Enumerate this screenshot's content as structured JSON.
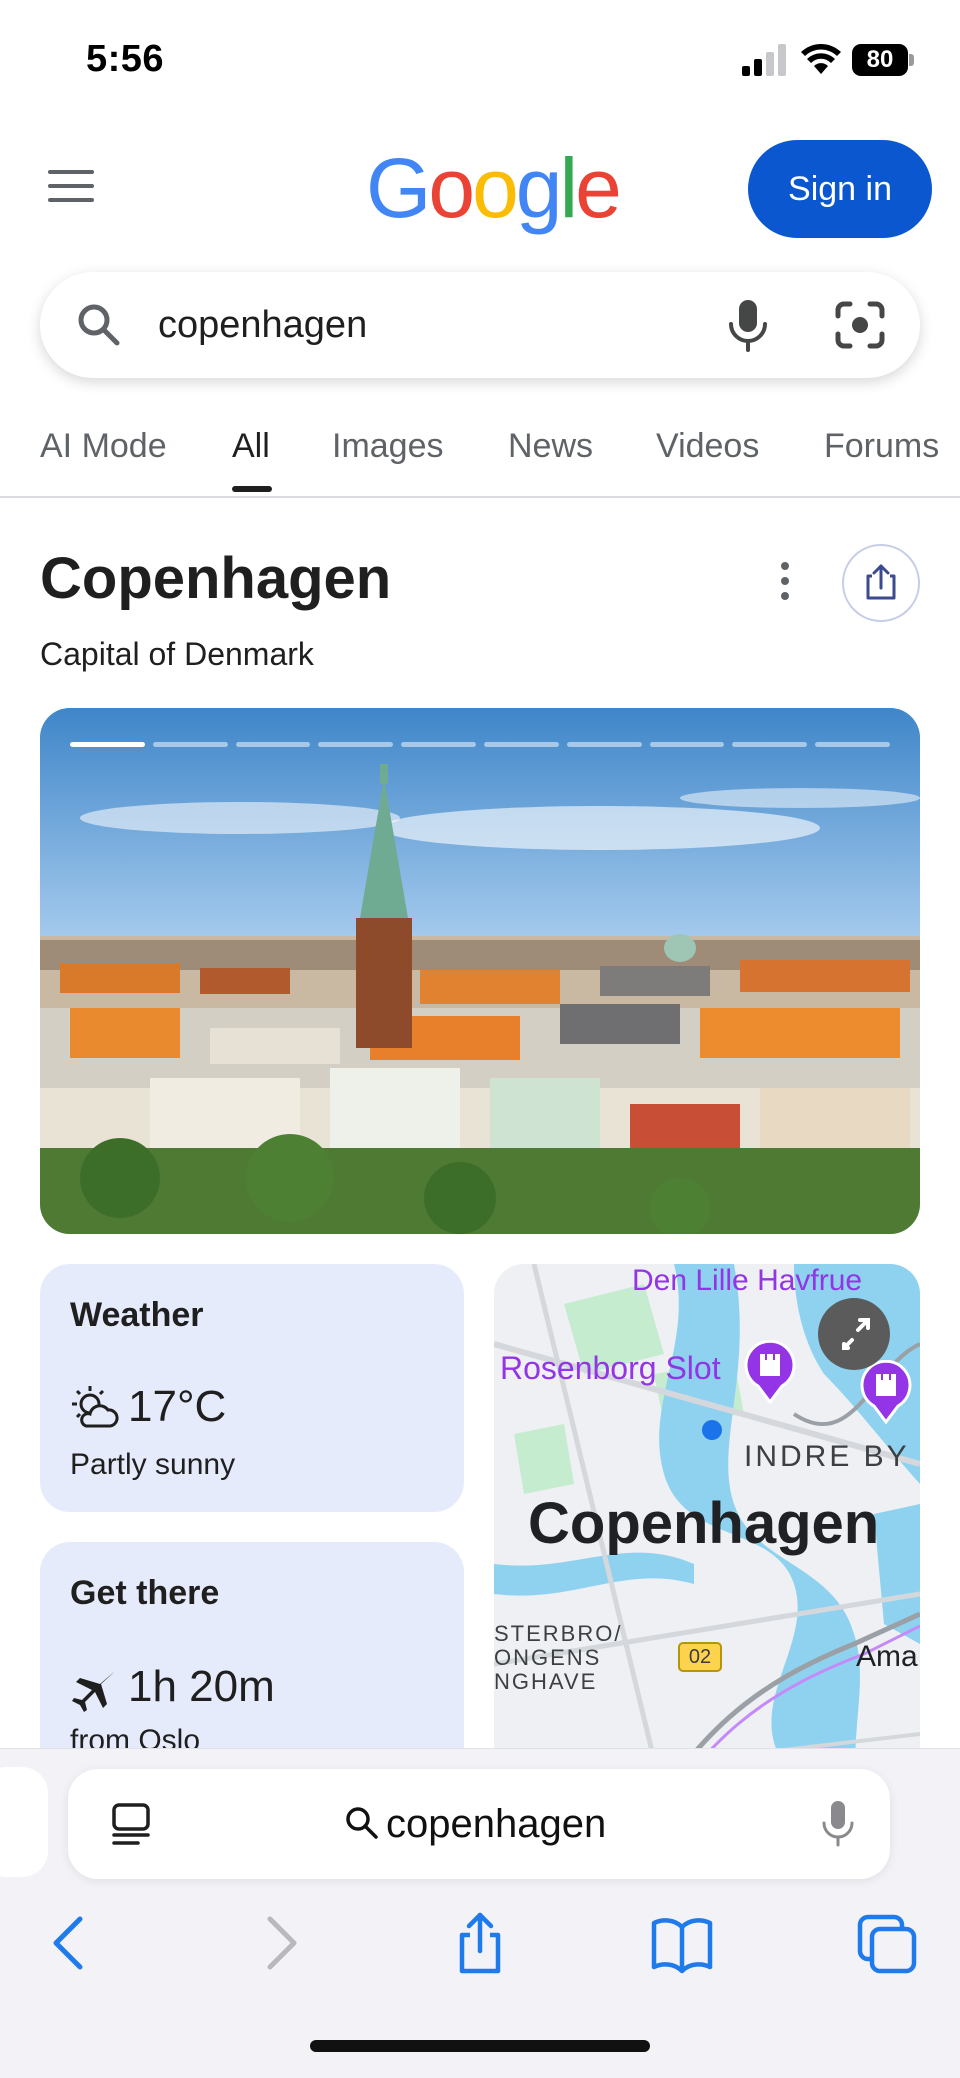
{
  "status_bar": {
    "time": "5:56",
    "battery": "80"
  },
  "header": {
    "logo_text": "Google",
    "sign_in": "Sign in"
  },
  "search": {
    "query": "copenhagen"
  },
  "tabs": [
    {
      "label": "AI Mode"
    },
    {
      "label": "All"
    },
    {
      "label": "Images"
    },
    {
      "label": "News"
    },
    {
      "label": "Videos"
    },
    {
      "label": "Forums"
    }
  ],
  "active_tab": "All",
  "knowledge_panel": {
    "title": "Copenhagen",
    "subtitle": "Capital of Denmark",
    "carousel": {
      "slide_count": 10,
      "current_slide": 1
    }
  },
  "weather": {
    "title": "Weather",
    "temperature": "17°C",
    "condition": "Partly sunny"
  },
  "get_there": {
    "title": "Get there",
    "duration": "1h 20m",
    "origin": "from Oslo"
  },
  "map": {
    "labels": {
      "havfrue": "Den Lille Havfrue",
      "rosenborg": "Rosenborg Slot",
      "indre_by": "INDRE BY",
      "city": "Copenhagen",
      "osterbro_1": "STERBRO/",
      "osterbro_2": "ONGENS",
      "osterbro_3": "NGHAVE",
      "route": "02",
      "amager": "Ama"
    }
  },
  "safari": {
    "address_text": "copenhagen"
  },
  "colors": {
    "accent": "#0b57d0",
    "card_bg": "#e6ebfc",
    "safari_blue": "#1f7aec",
    "poi_purple": "#9334e6"
  }
}
